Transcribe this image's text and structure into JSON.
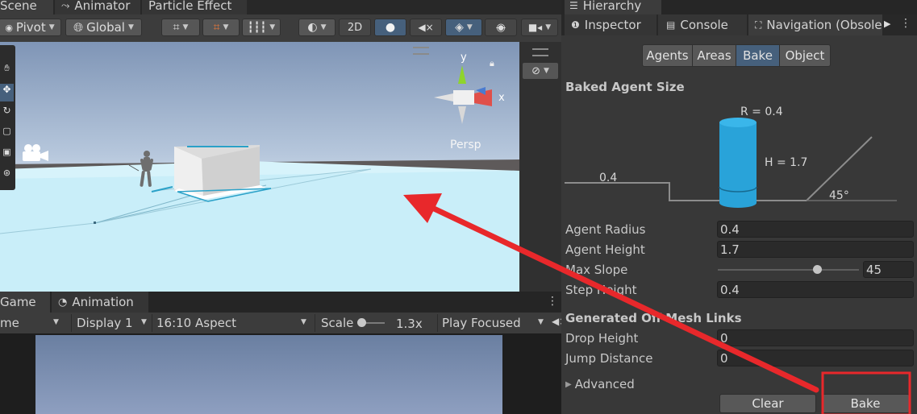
{
  "scene_tabs": {
    "scene": "Scene",
    "animator": "Animator",
    "particle_effect": "Particle Effect"
  },
  "scene_toolbar": {
    "pivot": "Pivot",
    "global": "Global",
    "mode_2d": "2D"
  },
  "scene_view": {
    "gizmo_y": "y",
    "gizmo_x": "x",
    "projection": "Persp"
  },
  "game_tabs": {
    "game": "Game",
    "animation": "Animation"
  },
  "game_toolbar": {
    "game_mode": "me",
    "display": "Display 1",
    "aspect": "16:10 Aspect",
    "scale_label": "Scale",
    "scale_value": "1.3x",
    "play_mode": "Play Focused"
  },
  "right_tabs": {
    "hierarchy": "Hierarchy",
    "inspector": "Inspector",
    "console": "Console",
    "navigation": "Navigation (Obsole"
  },
  "navigation": {
    "seg_tabs": [
      "Agents",
      "Areas",
      "Bake",
      "Object"
    ],
    "selected_tab": "Bake",
    "baked_agent_size_title": "Baked Agent Size",
    "diagram": {
      "radius_label": "R = 0.4",
      "height_label": "H = 1.7",
      "step_label": "0.4",
      "slope_label": "45°"
    },
    "fields": {
      "agent_radius_label": "Agent Radius",
      "agent_radius": "0.4",
      "agent_height_label": "Agent Height",
      "agent_height": "1.7",
      "max_slope_label": "Max Slope",
      "max_slope": "45",
      "max_slope_fraction": 0.7,
      "step_height_label": "Step Height",
      "step_height": "0.4"
    },
    "offmesh_title": "Generated Off Mesh Links",
    "offmesh": {
      "drop_height_label": "Drop Height",
      "drop_height": "0",
      "jump_distance_label": "Jump Distance",
      "jump_distance": "0"
    },
    "advanced_label": "Advanced",
    "clear_button": "Clear",
    "bake_button": "Bake"
  },
  "colors": {
    "accent_blue": "#29a3d9",
    "annotation_red": "#e8282b",
    "selected_tab": "#46607c"
  },
  "icons": [
    "unity-menu-icon",
    "animator-icon",
    "globe-icon",
    "grid-snap-icon",
    "light-icon",
    "audio-mute-icon",
    "fx-layers-icon",
    "visibility-icon",
    "camera-icon",
    "scene-camera-icon",
    "lock-icon",
    "info-icon",
    "console-icon",
    "navigation-icon",
    "kebab-menu-icon",
    "pacman-icon",
    "annotation-arrow"
  ]
}
